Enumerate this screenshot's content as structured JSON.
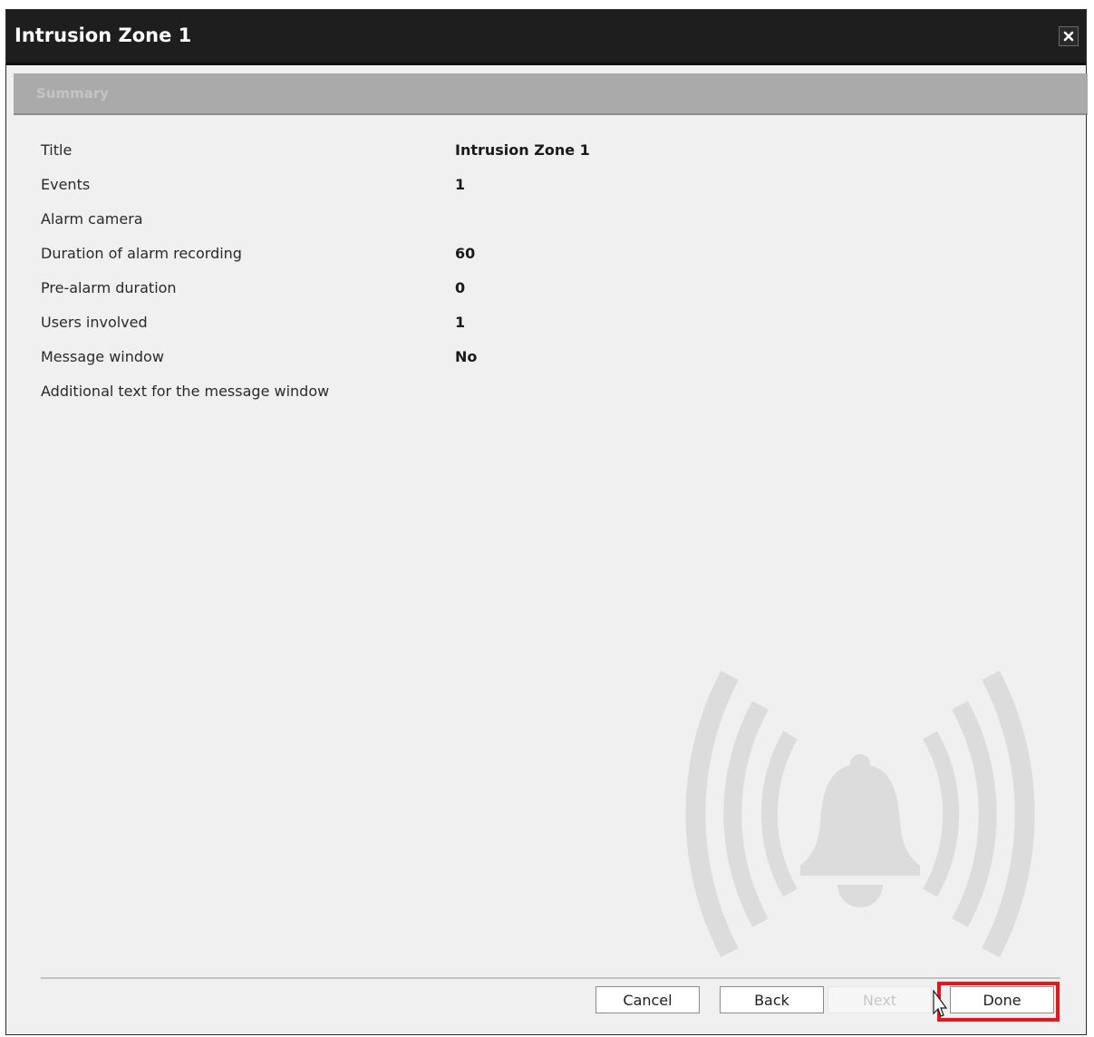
{
  "window": {
    "title": "Intrusion Zone 1"
  },
  "section": {
    "title": "Summary"
  },
  "summary": [
    {
      "label": "Title",
      "value": "Intrusion Zone 1"
    },
    {
      "label": "Events",
      "value": "1"
    },
    {
      "label": "Alarm camera",
      "value": ""
    },
    {
      "label": "Duration of alarm recording",
      "value": "60"
    },
    {
      "label": "Pre-alarm duration",
      "value": "0"
    },
    {
      "label": "Users involved",
      "value": "1"
    },
    {
      "label": "Message window",
      "value": "No"
    },
    {
      "label": "Additional text for the message window",
      "value": ""
    }
  ],
  "buttons": {
    "cancel": "Cancel",
    "back": "Back",
    "next": "Next",
    "done": "Done"
  },
  "icons": {
    "close": "close-icon",
    "watermark": "alarm-bell-icon",
    "cursor": "mouse-pointer-icon"
  },
  "colors": {
    "titlebar": "#1e1e1e",
    "section_header": "#aaaaaa",
    "highlight": "#e8141b"
  }
}
